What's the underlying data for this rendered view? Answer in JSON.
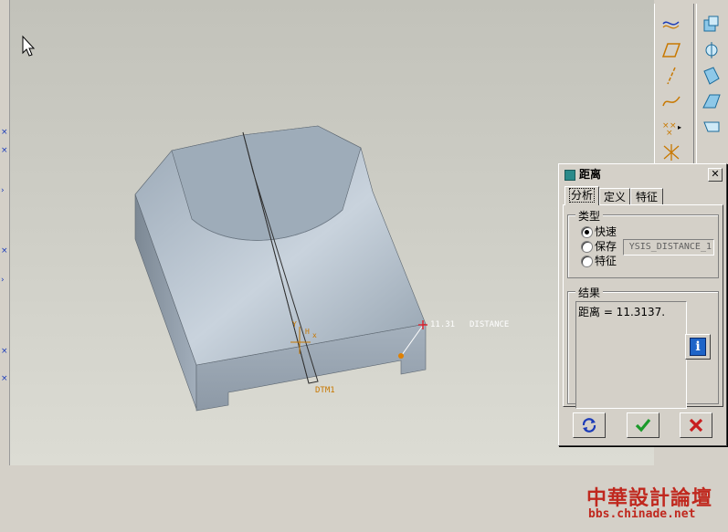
{
  "model_labels": {
    "dimension": "11.31",
    "distance": "DISTANCE",
    "datum": "DTM1"
  },
  "dialog": {
    "title": "距离",
    "close": "✕",
    "tabs": [
      "分析",
      "定义",
      "特征"
    ],
    "type_group": {
      "label": "类型",
      "options": [
        "快速",
        "保存",
        "特征"
      ],
      "selected": "快速",
      "name_value": "YSIS_DISTANCE_1"
    },
    "result_group": {
      "label": "结果",
      "text": "距离 = 11.3137."
    },
    "info_icon": "info-icon",
    "buttons": [
      "refresh-icon",
      "ok-check-icon",
      "cancel-x-icon"
    ]
  },
  "toolbar": {
    "icons_a": [
      "datum-curve-icon",
      "datum-plane-icon",
      "datum-axis-icon",
      "sketch-curve-icon",
      "datum-point-icon",
      "coordinate-system-icon"
    ],
    "icons_b": [
      "shell-feature-icon",
      "rib-feature-icon",
      "draft-feature-icon",
      "round-feature-icon",
      "chamfer-feature-icon"
    ]
  },
  "watermark": {
    "title": "中華設計論壇",
    "url": "bbs.chinade.net"
  },
  "colors": {
    "model_face_top": "#a9b6c3",
    "model_face_side": "#8f9ba8",
    "annotation": "#c87800",
    "watermark": "#c0281e"
  }
}
